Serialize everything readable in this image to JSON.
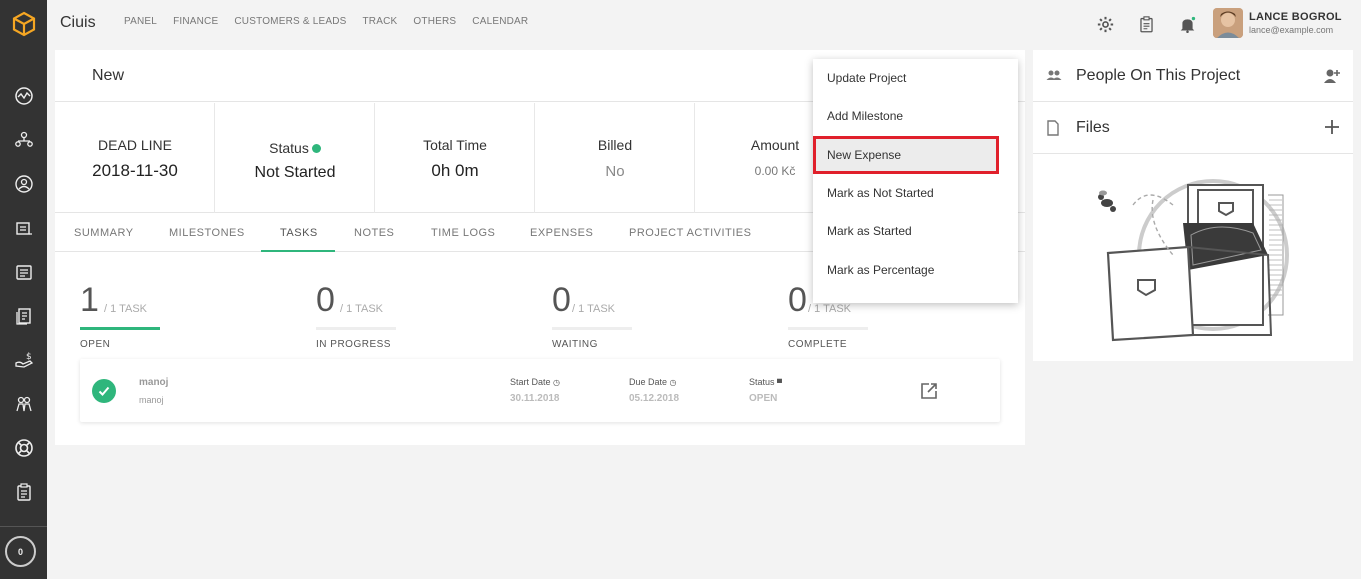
{
  "app": {
    "name": "Ciuis"
  },
  "topnav": [
    "PANEL",
    "FINANCE",
    "CUSTOMERS & LEADS",
    "TRACK",
    "OTHERS",
    "CALENDAR"
  ],
  "user": {
    "name": "LANCE BOGROL",
    "email": "lance@example.com"
  },
  "sidebar": {
    "icons": [
      "logo-icon",
      "dashboard-icon",
      "customers-icon",
      "leads-icon",
      "projects-icon",
      "invoices-icon",
      "documents-icon",
      "expenses-icon",
      "staff-icon",
      "support-icon",
      "tasks-icon"
    ],
    "timer": "0"
  },
  "project": {
    "title": "New",
    "stats": {
      "deadline_label": "DEAD LINE",
      "deadline_value": "2018-11-30",
      "status_label": "Status",
      "status_value": "Not Started",
      "total_time_label": "Total Time",
      "total_time_value": "0h 0m",
      "billed_label": "Billed",
      "billed_value": "No",
      "amount_label": "Amount",
      "amount_value": "0.00 Kč"
    },
    "tabs": [
      "SUMMARY",
      "MILESTONES",
      "TASKS",
      "NOTES",
      "TIME LOGS",
      "EXPENSES",
      "PROJECT ACTIVITIES"
    ],
    "active_tab": "TASKS",
    "counters": [
      {
        "num": "1",
        "of": "/ 1 TASK",
        "label": "OPEN",
        "progress": 1.0
      },
      {
        "num": "0",
        "of": "/ 1 TASK",
        "label": "IN PROGRESS",
        "progress": 0
      },
      {
        "num": "0",
        "of": "/ 1 TASK",
        "label": "WAITING",
        "progress": 0
      },
      {
        "num": "0",
        "of": "/ 1 TASK",
        "label": "COMPLETE",
        "progress": 0
      }
    ],
    "task": {
      "title": "manoj",
      "subtitle": "manoj",
      "start_label": "Start Date",
      "start_value": "30.11.2018",
      "due_label": "Due Date",
      "due_value": "05.12.2018",
      "status_label": "Status",
      "status_value": "OPEN"
    }
  },
  "dropdown": {
    "items": [
      "Update Project",
      "Add Milestone",
      "New Expense",
      "Mark as Not Started",
      "Mark as Started",
      "Mark as Percentage"
    ],
    "highlighted": "New Expense"
  },
  "right_panel": {
    "people_title": "People On This Project",
    "files_title": "Files"
  },
  "colors": {
    "accent": "#2fb67c",
    "highlight": "#e0202b",
    "sidebar": "#333333",
    "logo": "#f5a623"
  }
}
